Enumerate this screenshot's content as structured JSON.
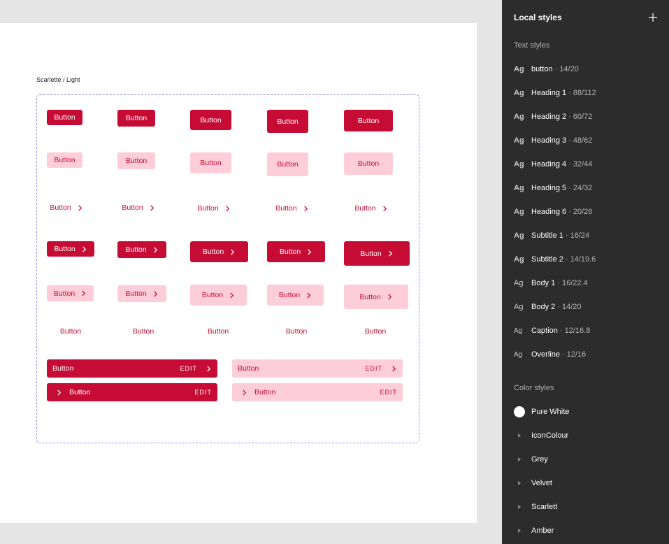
{
  "canvas": {
    "frame_label": "Scarlette / Light",
    "button_label": "Button",
    "edit_label": "EDIT"
  },
  "colors": {
    "primary": "#c60c35",
    "tonal": "#fdcdd9",
    "panel_bg": "#2c2c2c",
    "canvas_bg": "#e5e5e5",
    "selection_border": "#9b8cdc"
  },
  "panel": {
    "title": "Local styles",
    "add_icon": "plus-icon",
    "text_styles_title": "Text styles",
    "text_styles": [
      {
        "sample": "Ag",
        "name": "button",
        "spec": "· 14/20"
      },
      {
        "sample": "Ag",
        "name": "Heading 1",
        "spec": "· 88/112"
      },
      {
        "sample": "Ag",
        "name": "Heading 2",
        "spec": "· 60/72"
      },
      {
        "sample": "Ag",
        "name": "Heading 3",
        "spec": "· 48/62"
      },
      {
        "sample": "Ag",
        "name": "Heading 4",
        "spec": "· 32/44"
      },
      {
        "sample": "Ag",
        "name": "Heading 5",
        "spec": "· 24/32"
      },
      {
        "sample": "Ag",
        "name": "Heading 6",
        "spec": "· 20/26"
      },
      {
        "sample": "Ag",
        "name": "Subtitle 1",
        "spec": "· 16/24"
      },
      {
        "sample": "Ag",
        "name": "Subtitle 2",
        "spec": "· 14/19.6"
      },
      {
        "sample": "Ag",
        "name": "Body 1",
        "spec": "· 16/22.4"
      },
      {
        "sample": "Ag",
        "name": "Body 2",
        "spec": "· 14/20"
      },
      {
        "sample": "Ag",
        "name": "Caption",
        "spec": "· 12/16.8"
      },
      {
        "sample": "Ag",
        "name": "Overline",
        "spec": "· 12/16"
      }
    ],
    "color_styles_title": "Color styles",
    "color_styles": [
      {
        "name": "Pure White",
        "kind": "swatch",
        "color": "#ffffff"
      },
      {
        "name": "IconColour",
        "kind": "group"
      },
      {
        "name": "Grey",
        "kind": "group"
      },
      {
        "name": "Velvet",
        "kind": "group"
      },
      {
        "name": "Scarlett",
        "kind": "group"
      },
      {
        "name": "Amber",
        "kind": "group"
      }
    ]
  }
}
